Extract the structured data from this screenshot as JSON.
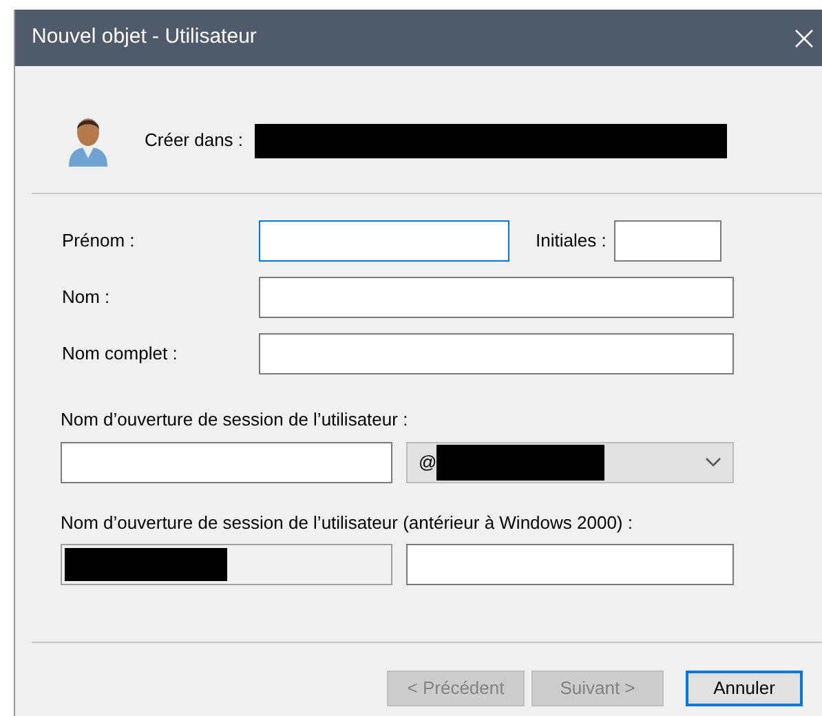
{
  "window": {
    "title": "Nouvel objet - Utilisateur"
  },
  "create_in": {
    "label": "Créer dans :",
    "redacted": true
  },
  "name_rows": [
    {
      "label": "Prénom :",
      "focused": true,
      "extra": {
        "label": "Initiales :",
        "focused": false
      }
    },
    {
      "label": "Nom :",
      "focused": false
    },
    {
      "label": "Nom complet :",
      "focused": false
    }
  ],
  "logon": {
    "label": "Nom d’ouverture de session de l’utilisateur :",
    "domain": {
      "prefix": "@",
      "redacted": true
    }
  },
  "logon_pre2000": {
    "label": "Nom d’ouverture de session de l’utilisateur (antérieur à Windows 2000) :",
    "domain": {
      "redacted": true,
      "disabled": true
    }
  },
  "buttons": [
    {
      "label": "< Précédent",
      "disabled": true,
      "default": false
    },
    {
      "label": "Suivant >",
      "disabled": true,
      "default": false
    },
    {
      "label": "Annuler",
      "disabled": false,
      "default": true
    }
  ]
}
